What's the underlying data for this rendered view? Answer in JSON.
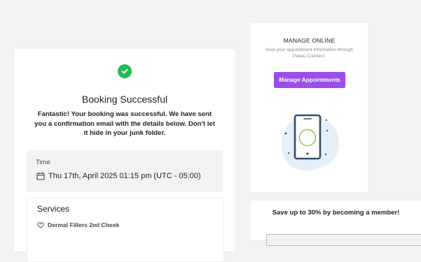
{
  "booking": {
    "title": "Booking Successful",
    "message": "Fantastic! Your booking was successful. We have sent you a confirmation email with the details below. Don't let it hide in your junk folder.",
    "time_label": "Time",
    "time_value": "Thu 17th,  April 2025 01:15 pm (UTC - 05:00)",
    "services_title": "Services",
    "service_item": "Dermal Fillers 2ml Cheek",
    "icons": {
      "success": "check-circle-icon",
      "time": "calendar-icon",
      "service": "heart-icon"
    },
    "accent_color": "#22bb55"
  },
  "manage": {
    "title": "MANAGE ONLINE",
    "description": "View your appointment information through Pabau Connect.",
    "button_label": "Manage Appointments",
    "button_color": "#9b4ee8",
    "illustration": "phone-illustration"
  },
  "member": {
    "title": "Save up to 30% by becoming a member!"
  }
}
